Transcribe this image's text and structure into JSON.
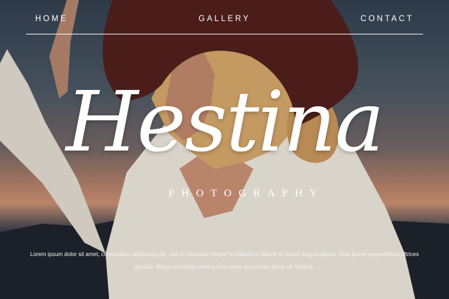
{
  "nav": {
    "home": "HOME",
    "gallery": "GALLERY",
    "contact": "CONTACT"
  },
  "hero": {
    "brand": "Hestina",
    "subtitle": "PHOTOGRAPHY",
    "description": "Lorem ipsum dolor sit amet, consectetur adipiscing elit, sed do eiusmod tempor incididunt ut labore et dolore magna aliqua. Quis ipsum suspendisse ultrices gravida. Risus commodo viverra maecenas accumsan lacus vel facilisis."
  },
  "colors": {
    "hat": "#4a1d1a",
    "shirt": "#d9d4ca",
    "hair": "#c49a63",
    "skin": "#b8846a",
    "sunset": "#b9856a"
  }
}
